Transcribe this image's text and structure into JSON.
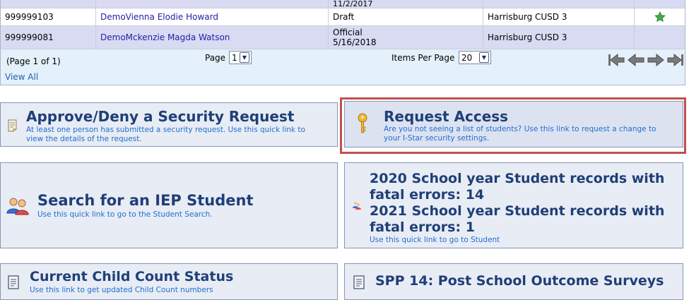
{
  "students": {
    "rows": [
      {
        "id": "",
        "name": "",
        "status": "11/2/2017",
        "status_date": "",
        "district": "",
        "favorite": false
      },
      {
        "id": "999999103",
        "name": "DemoVienna Elodie Howard",
        "status": "Draft",
        "status_date": "",
        "district": "Harrisburg CUSD 3",
        "favorite": true
      },
      {
        "id": "999999081",
        "name": "DemoMckenzie Magda Watson",
        "status": "Official",
        "status_date": "5/16/2018",
        "district": "Harrisburg CUSD 3",
        "favorite": false
      }
    ]
  },
  "pager": {
    "page_info": "(Page 1 of 1)",
    "page_label": "Page",
    "page_value": "1",
    "items_label": "Items Per Page",
    "items_value": "20",
    "view_all": "View All"
  },
  "panels": {
    "approve": {
      "title": "Approve/Deny a Security Request",
      "desc1": "At least one person has submitted a security request. Use this quick link to",
      "desc2": "view the details of the request."
    },
    "request": {
      "title": "Request Access",
      "desc1": "Are you not seeing a list of students? Use this link to request a change to",
      "desc2": "your I-Star security settings."
    },
    "search": {
      "title": "Search for an IEP Student",
      "desc": "Use this quick link to go to the Student Search."
    },
    "fatal": {
      "line1": "2020 School year Student records with",
      "line2": "fatal errors: 14",
      "line3": "2021 School year Student records with",
      "line4": "fatal errors: 1",
      "desc": "Use this quick link to go to Student"
    },
    "childcount": {
      "title": "Current Child Count Status",
      "desc": "Use this link to get updated Child Count numbers"
    },
    "spp": {
      "title": "SPP 14: Post School Outcome Surveys"
    }
  },
  "icons": {
    "star": "star-icon",
    "note": "note-icon",
    "key": "key-icon",
    "people": "people-icon",
    "document": "document-icon"
  },
  "colors": {
    "title": "#1f3f78",
    "link": "#1f6fd0",
    "highlight_frame": "#c0504d",
    "row_alt": "#d9dbf2",
    "pager_bg": "#e4f0fa",
    "star": "#2e9e3a"
  }
}
